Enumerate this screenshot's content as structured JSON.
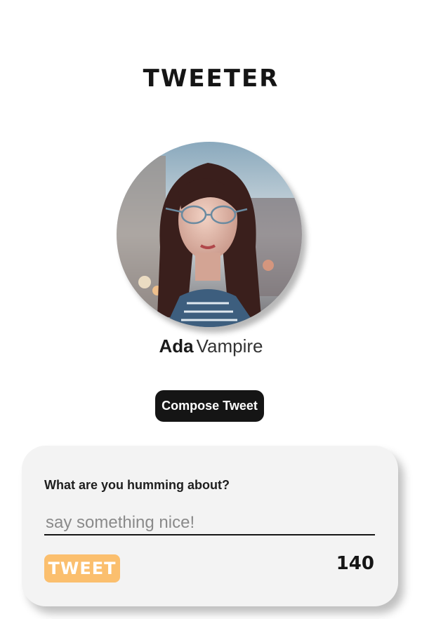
{
  "app": {
    "title": "TWEETER"
  },
  "profile": {
    "first_name": "Ada",
    "last_name": "Vampire",
    "avatar_icon": "user-photo"
  },
  "compose": {
    "button_label": "Compose Tweet"
  },
  "tweet_form": {
    "prompt": "What are you humming about?",
    "input_value": "",
    "input_placeholder": "say something nice!",
    "submit_label": "TWEET",
    "remaining_chars": "140"
  },
  "colors": {
    "accent": "#fbbf6e",
    "primary_dark": "#151515",
    "card_bg": "#f3f3f3"
  }
}
